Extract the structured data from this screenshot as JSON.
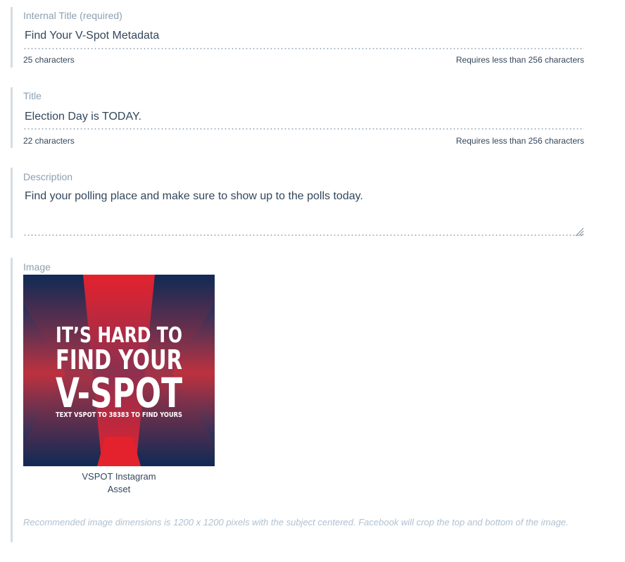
{
  "internal_title": {
    "label": "Internal Title (required)",
    "value": "Find Your V-Spot Metadata",
    "count": "25 characters",
    "limit": "Requires less than 256 characters"
  },
  "title": {
    "label": "Title",
    "value": "Election Day is TODAY.",
    "count": "22 characters",
    "limit": "Requires less than 256 characters"
  },
  "description": {
    "label": "Description",
    "value": "Find your polling place and make sure to show up to the polls today."
  },
  "image": {
    "label": "Image",
    "artwork": {
      "line1": "IT’S HARD TO",
      "line2": "FIND YOUR",
      "line3": "V-SPOT",
      "line4": "TEXT VSPOT TO 38383 TO FIND YOURS"
    },
    "caption_line1": "VSPOT Instagram",
    "caption_line2": "Asset",
    "hint": "Recommended image dimensions is 1200 x 1200 pixels with the subject centered. Facebook will crop the top and bottom of the image."
  },
  "colors": {
    "navy": "#0f2a55",
    "red": "#e3222e",
    "label": "#8da0b1",
    "text": "#33475b",
    "border": "#d6dde3"
  }
}
